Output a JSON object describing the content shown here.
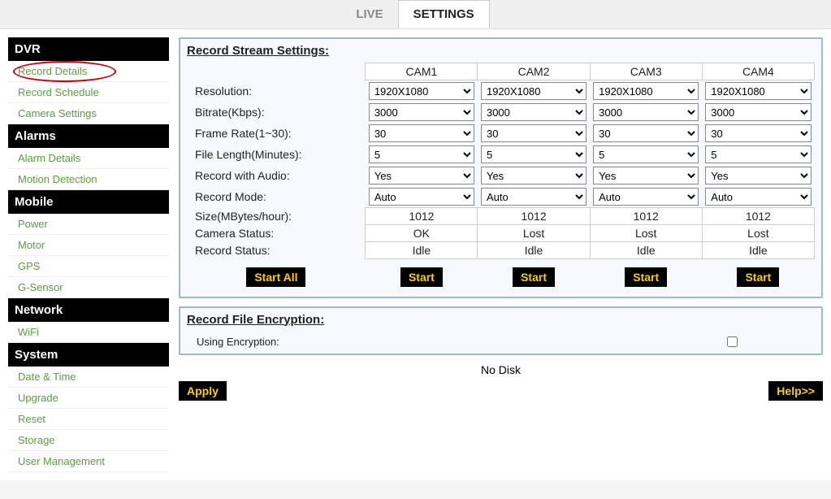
{
  "tabs": {
    "live": "LIVE",
    "settings": "SETTINGS"
  },
  "sidebar": {
    "dvr": {
      "header": "DVR",
      "record_details": "Record Details",
      "record_schedule": "Record Schedule",
      "camera_settings": "Camera Settings"
    },
    "alarms": {
      "header": "Alarms",
      "alarm_details": "Alarm Details",
      "motion_detection": "Motion Detection"
    },
    "mobile": {
      "header": "Mobile",
      "power": "Power",
      "motor": "Motor",
      "gps": "GPS",
      "gsensor": "G-Sensor"
    },
    "network": {
      "header": "Network",
      "wifi": "WiFi"
    },
    "system": {
      "header": "System",
      "datetime": "Date & Time",
      "upgrade": "Upgrade",
      "reset": "Reset",
      "storage": "Storage",
      "user_mgmt": "User Management"
    }
  },
  "panel": {
    "title": "Record Stream Settings:",
    "cols": [
      "CAM1",
      "CAM2",
      "CAM3",
      "CAM4"
    ],
    "rows": {
      "resolution": "Resolution:",
      "bitrate": "Bitrate(Kbps):",
      "framerate": "Frame Rate(1~30):",
      "filelen": "File Length(Minutes):",
      "audio": "Record with Audio:",
      "mode": "Record Mode:",
      "size": "Size(MBytes/hour):",
      "camstatus": "Camera Status:",
      "recstatus": "Record Status:"
    },
    "data": {
      "cam1": {
        "resolution": "1920X1080",
        "bitrate": "3000",
        "framerate": "30",
        "filelen": "5",
        "audio": "Yes",
        "mode": "Auto",
        "size": "1012",
        "camstatus": "OK",
        "recstatus": "Idle"
      },
      "cam2": {
        "resolution": "1920X1080",
        "bitrate": "3000",
        "framerate": "30",
        "filelen": "5",
        "audio": "Yes",
        "mode": "Auto",
        "size": "1012",
        "camstatus": "Lost",
        "recstatus": "Idle"
      },
      "cam3": {
        "resolution": "1920X1080",
        "bitrate": "3000",
        "framerate": "30",
        "filelen": "5",
        "audio": "Yes",
        "mode": "Auto",
        "size": "1012",
        "camstatus": "Lost",
        "recstatus": "Idle"
      },
      "cam4": {
        "resolution": "1920X1080",
        "bitrate": "3000",
        "framerate": "30",
        "filelen": "5",
        "audio": "Yes",
        "mode": "Auto",
        "size": "1012",
        "camstatus": "Lost",
        "recstatus": "Idle"
      }
    },
    "start_all": "Start All",
    "start": "Start"
  },
  "encryption": {
    "title": "Record File Encryption",
    "using": "Using Encryption:",
    "nodisk": "No Disk"
  },
  "buttons": {
    "apply": "Apply",
    "help": "Help>>"
  }
}
